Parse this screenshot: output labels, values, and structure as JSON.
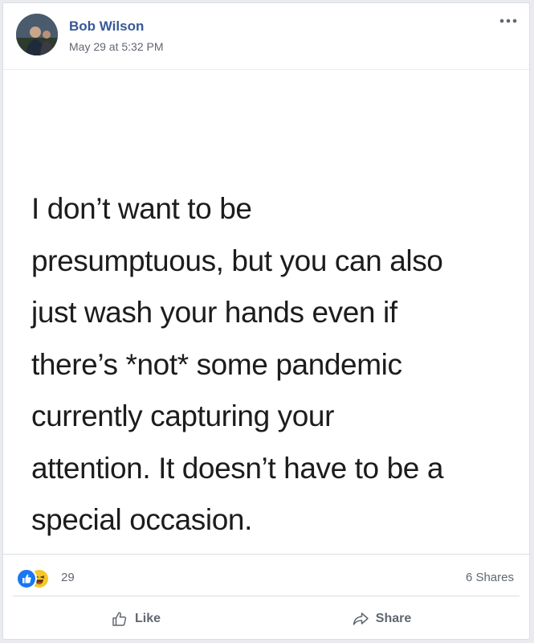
{
  "post": {
    "author": "Bob Wilson",
    "timestamp": "May 29 at 5:32 PM",
    "quote_lines": [
      "I don’t want to be",
      "presumptuous, but you can also",
      "just wash your hands even if",
      "there’s *not* some pandemic",
      "currently capturing your",
      "attention. It doesn’t have to be a",
      "special occasion."
    ]
  },
  "stats": {
    "reaction_count": "29",
    "shares": "6 Shares",
    "reaction_icons": [
      "like-reaction-icon",
      "haha-reaction-icon"
    ]
  },
  "actions": {
    "like_label": "Like",
    "share_label": "Share"
  },
  "colors": {
    "author": "#385898",
    "meta": "#606770",
    "like_blue": "#1877f2",
    "haha_yellow": "#f7c52b"
  }
}
